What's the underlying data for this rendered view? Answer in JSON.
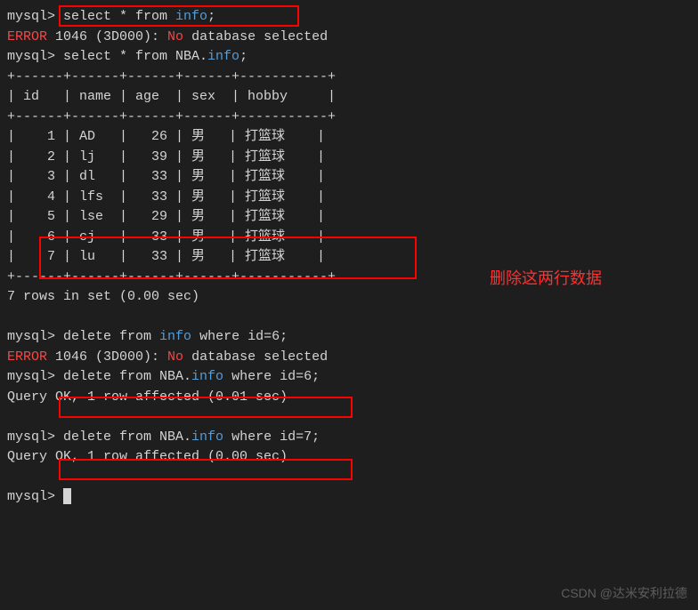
{
  "prompt": "mysql> ",
  "lines": {
    "cmd1_pre": "select * from ",
    "cmd1_info": "info",
    "cmd1_post": ";",
    "err1_pre": "ERROR",
    "err1_mid": " 1046 (3D000): ",
    "err1_no": "No",
    "err1_post": " database selected",
    "cmd2_pre": "select * from NBA.",
    "cmd2_info": "info",
    "cmd2_post": ";",
    "tborder": "+------+------+------+------+-----------+",
    "thead": "| id   | name | age  | sex  | hobby     |",
    "rows": [
      "|    1 | AD   |   26 | 男   | 打篮球    |",
      "|    2 | lj   |   39 | 男   | 打篮球    |",
      "|    3 | dl   |   33 | 男   | 打篮球    |",
      "|    4 | lfs  |   33 | 男   | 打篮球    |",
      "|    5 | lse  |   29 | 男   | 打篮球    |",
      "|    6 | cj   |   33 | 男   | 打篮球    |",
      "|    7 | lu   |   33 | 男   | 打篮球    |"
    ],
    "result1": "7 rows in set (0.00 sec)",
    "cmd3_pre": "delete from ",
    "cmd3_info": "info",
    "cmd3_post": " where id=6;",
    "err2_pre": "ERROR",
    "err2_mid": " 1046 (3D000): ",
    "err2_no": "No",
    "err2_post": " database selected",
    "cmd4_pre": "delete from NBA.",
    "cmd4_info": "info",
    "cmd4_post": " where id=6;",
    "result2": "Query OK, 1 row affected (0.01 sec)",
    "cmd5_pre": "delete from NBA.",
    "cmd5_info": "info",
    "cmd5_post": " where id=7;",
    "result3": "Query OK, 1 row affected (0.00 sec)"
  },
  "annotation": "删除这两行数据",
  "watermark": "CSDN @达米安利拉德",
  "chart_data": {
    "type": "table",
    "columns": [
      "id",
      "name",
      "age",
      "sex",
      "hobby"
    ],
    "rows": [
      {
        "id": 1,
        "name": "AD",
        "age": 26,
        "sex": "男",
        "hobby": "打篮球"
      },
      {
        "id": 2,
        "name": "lj",
        "age": 39,
        "sex": "男",
        "hobby": "打篮球"
      },
      {
        "id": 3,
        "name": "dl",
        "age": 33,
        "sex": "男",
        "hobby": "打篮球"
      },
      {
        "id": 4,
        "name": "lfs",
        "age": 33,
        "sex": "男",
        "hobby": "打篮球"
      },
      {
        "id": 5,
        "name": "lse",
        "age": 29,
        "sex": "男",
        "hobby": "打篮球"
      },
      {
        "id": 6,
        "name": "cj",
        "age": 33,
        "sex": "男",
        "hobby": "打篮球"
      },
      {
        "id": 7,
        "name": "lu",
        "age": 33,
        "sex": "男",
        "hobby": "打篮球"
      }
    ]
  }
}
